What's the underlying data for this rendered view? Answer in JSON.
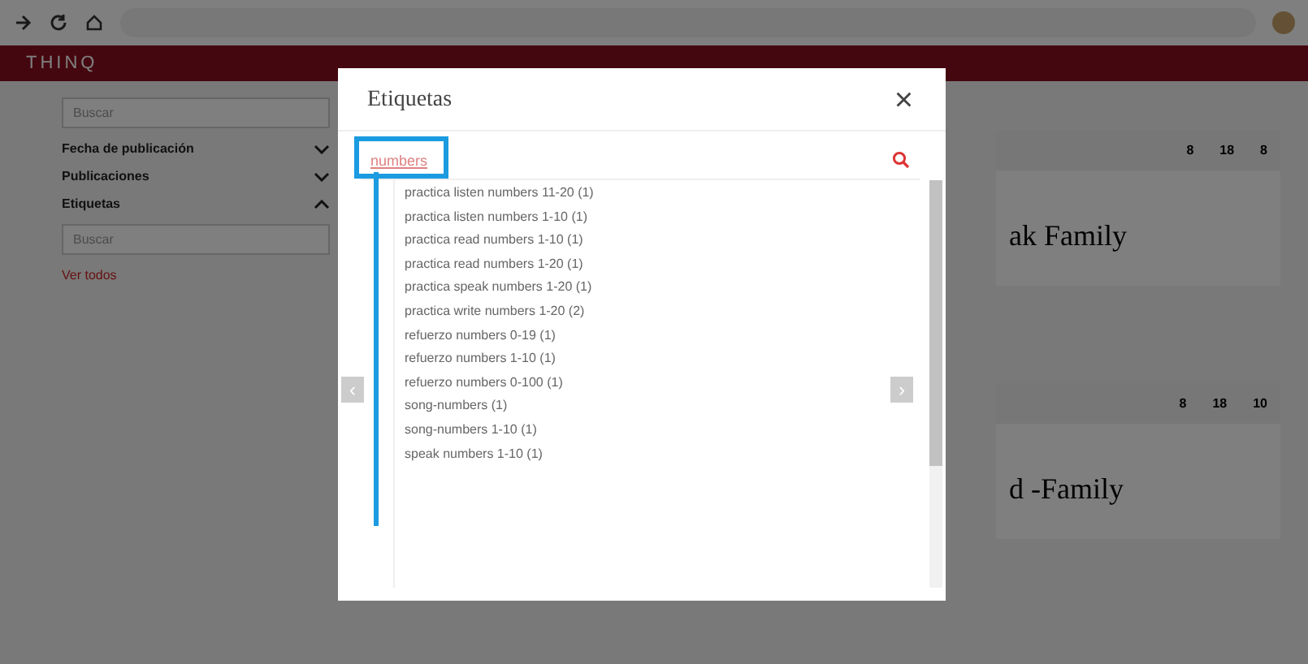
{
  "header": {
    "logo": "THINQ"
  },
  "sidebar": {
    "search_placeholder": "Buscar",
    "sections": [
      {
        "title": "Fecha de publicación",
        "expanded": false
      },
      {
        "title": "Publicaciones",
        "expanded": false
      },
      {
        "title": "Etiquetas",
        "expanded": true
      }
    ],
    "tag_search_placeholder": "Buscar",
    "see_all": "Ver todos"
  },
  "cards": [
    {
      "stats": [
        "8",
        "18",
        "8"
      ],
      "title": "ak Family"
    },
    {
      "stats": [
        "8",
        "18",
        "10"
      ],
      "title": "d -Family"
    }
  ],
  "modal": {
    "title": "Etiquetas",
    "close": "×",
    "search_value": "numbers",
    "items": [
      "practica listen numbers 11-20 (1)",
      "practica listen numbers 1-10 (1)",
      "practica read numbers 1-10 (1)",
      "practica read numbers 1-20 (1)",
      "practica speak numbers 1-20 (1)",
      "practica write numbers 1-20 (2)",
      "refuerzo numbers 0-19 (1)",
      "refuerzo numbers 1-10 (1)",
      "refuerzo numbers 0-100 (1)",
      "song-numbers (1)",
      "song-numbers 1-10 (1)",
      "speak numbers 1-10 (1)"
    ],
    "prev": "‹",
    "next": "›"
  }
}
